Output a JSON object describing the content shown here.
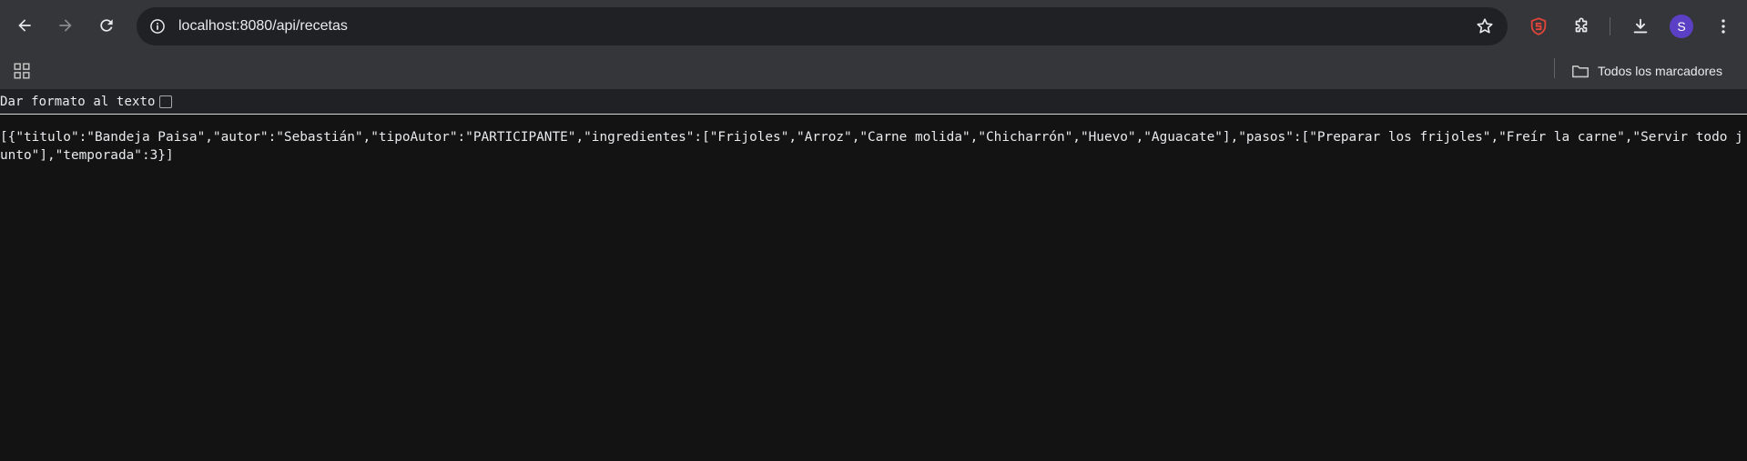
{
  "browser": {
    "url": "localhost:8080/api/recetas",
    "avatar_initial": "S",
    "bookmarks": {
      "all_bookmarks_label": "Todos los marcadores"
    }
  },
  "json_viewer": {
    "pretty_print_label": "Dar formato al texto",
    "pretty_print_checked": false,
    "raw_json": "[{\"titulo\":\"Bandeja Paisa\",\"autor\":\"Sebastián\",\"tipoAutor\":\"PARTICIPANTE\",\"ingredientes\":[\"Frijoles\",\"Arroz\",\"Carne molida\",\"Chicharrón\",\"Huevo\",\"Aguacate\"],\"pasos\":[\"Preparar los frijoles\",\"Freír la carne\",\"Servir todo junto\"],\"temporada\":3}]"
  },
  "colors": {
    "toolbar": "#35363a",
    "omnibox": "#202124",
    "page_background": "#131313",
    "text": "#e8eaed",
    "avatar": "#5b3fc4",
    "extension_accent": "#e0453a"
  }
}
